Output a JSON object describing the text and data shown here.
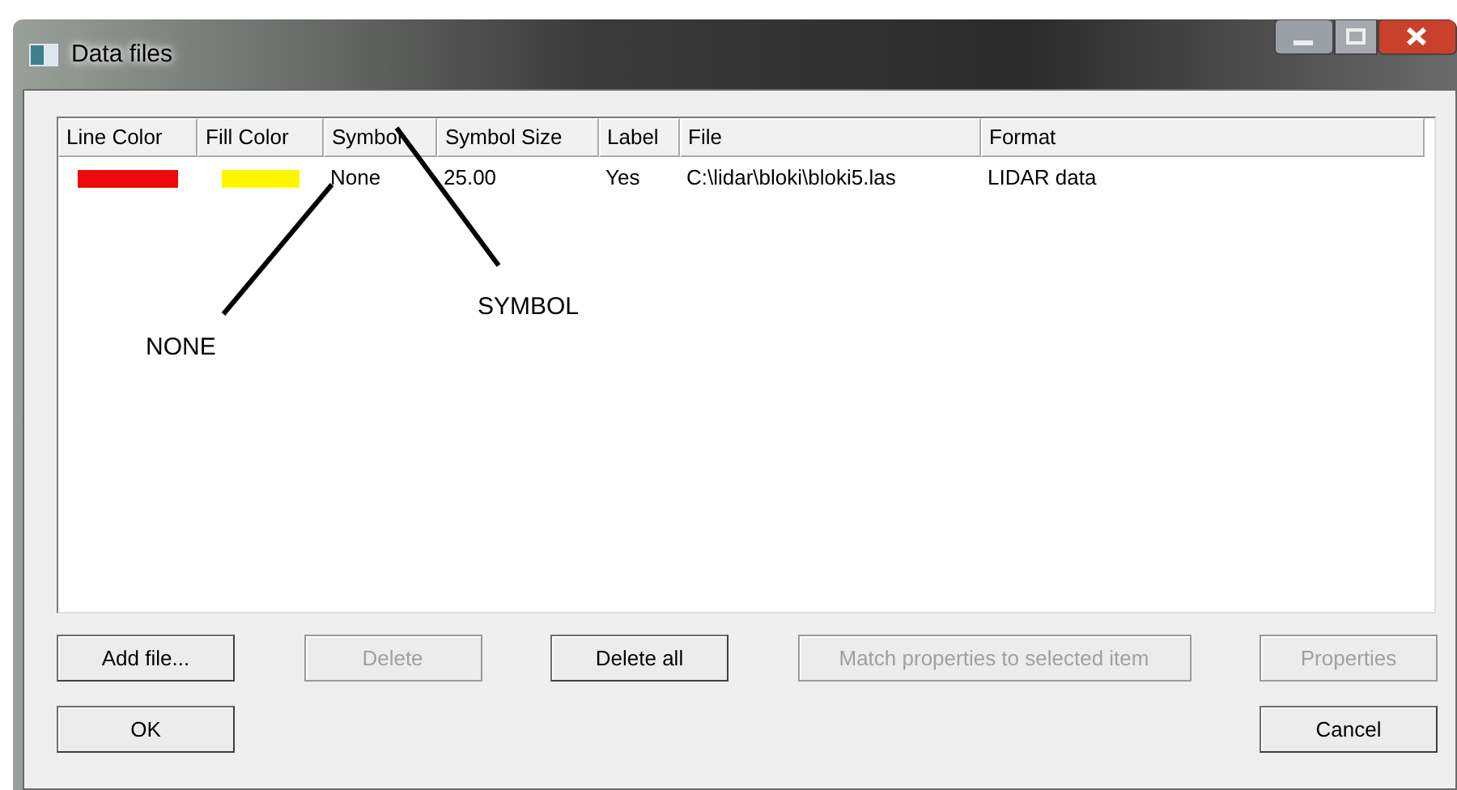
{
  "window": {
    "title": "Data files"
  },
  "list": {
    "columns": [
      "Line Color",
      "Fill Color",
      "Symbol",
      "Symbol Size",
      "Label",
      "File",
      "Format"
    ],
    "rows": [
      {
        "line_color": {
          "color": "#ee0a0a"
        },
        "fill_color": {
          "color": "#fff700"
        },
        "symbol": "None",
        "symbol_size": "25.00",
        "label": "Yes",
        "file": "C:\\lidar\\bloki\\bloki5.las",
        "format": "LIDAR data"
      }
    ]
  },
  "annotations": [
    {
      "text": "NONE"
    },
    {
      "text": "SYMBOL"
    }
  ],
  "buttons": [
    {
      "label": "Add file...",
      "disabled": false
    },
    {
      "label": "Delete",
      "disabled": true
    },
    {
      "label": "Delete all",
      "disabled": false
    },
    {
      "label": "Match properties to selected item",
      "disabled": true
    },
    {
      "label": "Properties",
      "disabled": true
    }
  ],
  "dialog_buttons": [
    {
      "label": "OK",
      "disabled": false
    },
    {
      "label": "Cancel",
      "disabled": false
    }
  ]
}
